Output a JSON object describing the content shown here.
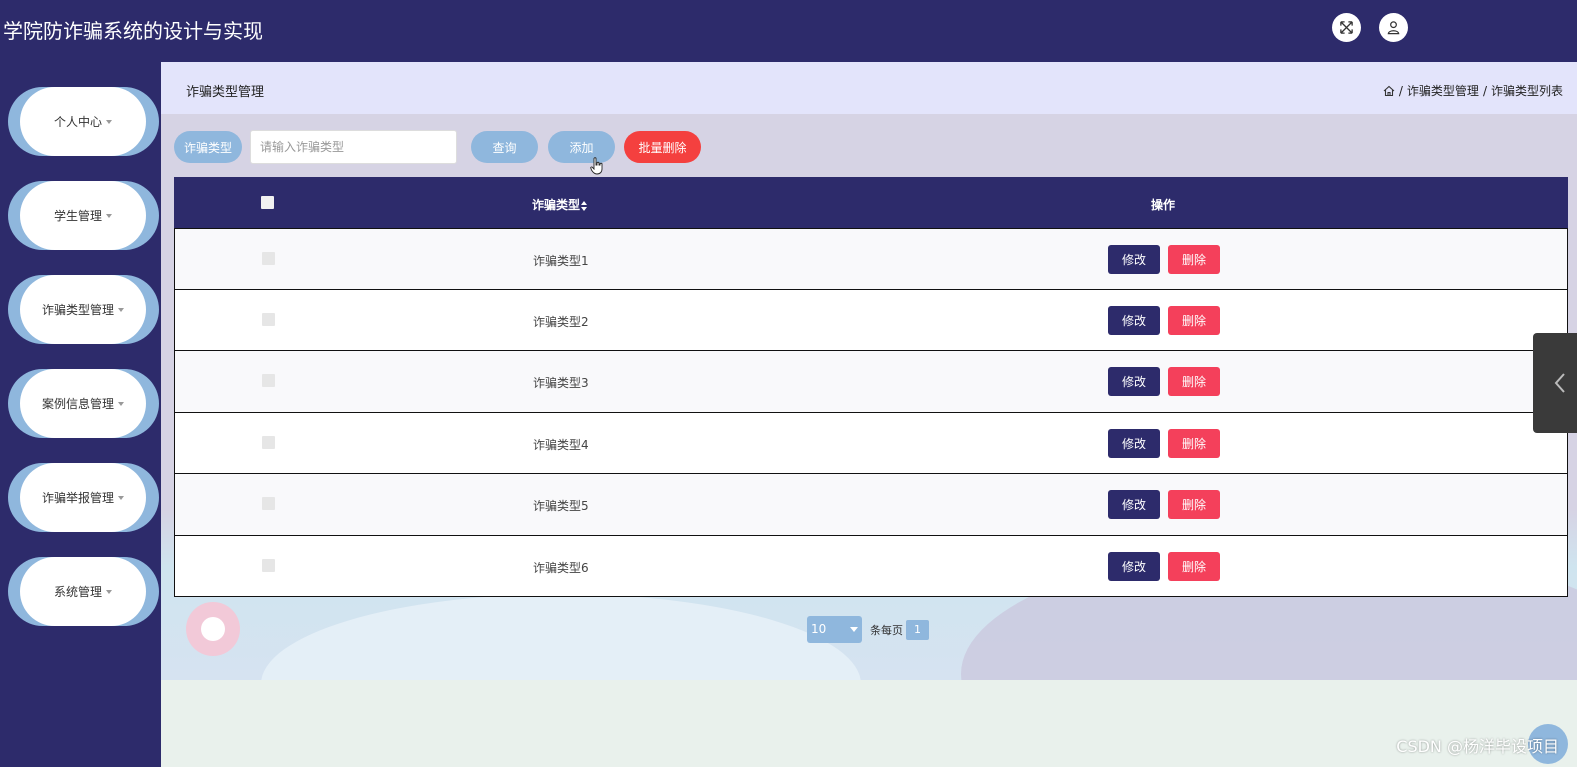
{
  "header": {
    "title": "学院防诈骗系统的设计与实现",
    "fullscreen_icon": "expand-icon",
    "user_icon": "user-icon"
  },
  "sidebar": {
    "items": [
      {
        "label": "个人中心"
      },
      {
        "label": "学生管理"
      },
      {
        "label": "诈骗类型管理"
      },
      {
        "label": "案例信息管理"
      },
      {
        "label": "诈骗举报管理"
      },
      {
        "label": "系统管理"
      }
    ]
  },
  "page": {
    "title": "诈骗类型管理",
    "breadcrumb": [
      "诈骗类型管理",
      "诈骗类型列表"
    ],
    "breadcrumb_sep": "/"
  },
  "search": {
    "label": "诈骗类型",
    "placeholder": "请输入诈骗类型",
    "value": ""
  },
  "toolbar": {
    "query_label": "查询",
    "add_label": "添加",
    "batch_delete_label": "批量删除"
  },
  "table": {
    "columns": [
      "诈骗类型",
      "操作"
    ],
    "edit_label": "修改",
    "delete_label": "删除",
    "rows": [
      {
        "type": "诈骗类型1"
      },
      {
        "type": "诈骗类型2"
      },
      {
        "type": "诈骗类型3"
      },
      {
        "type": "诈骗类型4"
      },
      {
        "type": "诈骗类型5"
      },
      {
        "type": "诈骗类型6"
      }
    ]
  },
  "pagination": {
    "page_size": "10",
    "per_page_label": "条每页",
    "current_page": "1"
  },
  "watermark": "CSDN @杨洋毕设项目",
  "colors": {
    "primary": "#2d2b6b",
    "accent": "#8fb7dd",
    "danger": "#f4405b"
  }
}
